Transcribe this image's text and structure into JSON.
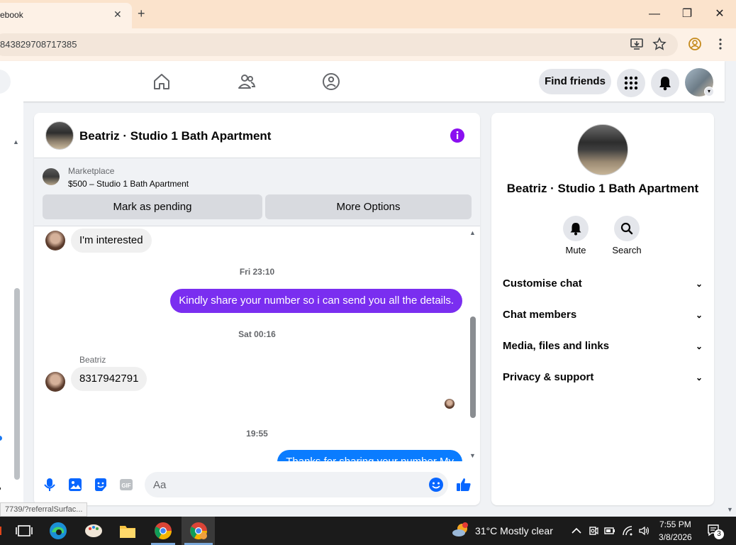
{
  "browser": {
    "tab_title": "ebook",
    "tab_close": "✕",
    "new_tab": "+",
    "url": "843829708717385",
    "window_controls": {
      "minimize": "—",
      "restore": "❐",
      "close": "✕"
    }
  },
  "header": {
    "find_friends": "Find friends"
  },
  "conversation": {
    "title": "Beatriz · Studio 1 Bath Apartment",
    "marketplace_label": "Marketplace",
    "listing": "$500 – Studio 1 Bath Apartment",
    "mark_pending": "Mark as pending",
    "more_options": "More Options",
    "messages": [
      {
        "type": "in",
        "text": "I'm interested"
      },
      {
        "type": "time",
        "text": "Fri 23:10"
      },
      {
        "type": "out",
        "text": "Kindly share your number so i can send you all the details."
      },
      {
        "type": "time",
        "text": "Sat 00:16"
      },
      {
        "type": "sender",
        "text": "Beatriz"
      },
      {
        "type": "in",
        "text": "8317942791"
      },
      {
        "type": "time",
        "text": "19:55"
      },
      {
        "type": "out",
        "text": "Thanks for sharing your number My"
      }
    ],
    "composer_placeholder": "Aa"
  },
  "details": {
    "name": "Beatriz · Studio 1 Bath Apartment",
    "mute": "Mute",
    "search": "Search",
    "rows": [
      "Customise chat",
      "Chat members",
      "Media, files and links",
      "Privacy & support"
    ]
  },
  "status_url": "7739/?referralSurfac...",
  "taskbar": {
    "weather": "31°C  Mostly clear",
    "time": "7:55 PM",
    "date": "3/8/2026",
    "notifications": "3"
  },
  "colors": {
    "accent_purple": "#7a2ef0",
    "messenger_blue": "#0a7cff",
    "fb_blue": "#1877f2"
  }
}
